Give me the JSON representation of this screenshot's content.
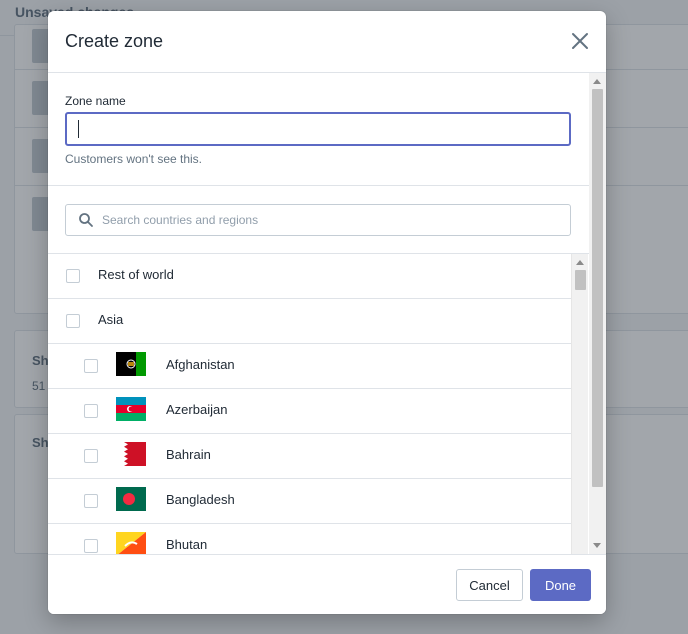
{
  "background": {
    "topbar_title": "Unsaved changes",
    "card2_title": "Sh",
    "card2_subtitle": "51",
    "card3_title": "Sh"
  },
  "modal": {
    "title": "Create zone",
    "close_icon": "close-icon",
    "zone_name": {
      "label": "Zone name",
      "value": "",
      "help_text": "Customers won't see this."
    },
    "search": {
      "icon": "search-icon",
      "placeholder": "Search countries and regions"
    },
    "regions": [
      {
        "label": "Rest of world",
        "level": "top",
        "checked": false
      },
      {
        "label": "Asia",
        "level": "top",
        "checked": false
      },
      {
        "label": "Afghanistan",
        "level": "country",
        "flag": "flag-afghanistan",
        "checked": false
      },
      {
        "label": "Azerbaijan",
        "level": "country",
        "flag": "flag-azerbaijan",
        "checked": false
      },
      {
        "label": "Bahrain",
        "level": "country",
        "flag": "flag-bahrain",
        "checked": false
      },
      {
        "label": "Bangladesh",
        "level": "country",
        "flag": "flag-bangladesh",
        "checked": false
      },
      {
        "label": "Bhutan",
        "level": "country",
        "flag": "flag-bhutan",
        "checked": false
      }
    ],
    "footer": {
      "cancel_label": "Cancel",
      "done_label": "Done"
    }
  },
  "colors": {
    "primary": "#5c6ac4",
    "border": "#dfe3e8",
    "text": "#212b36",
    "subdued": "#637381"
  }
}
